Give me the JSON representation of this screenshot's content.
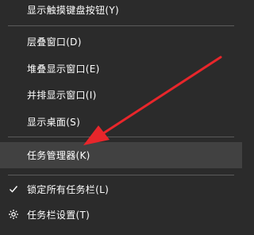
{
  "menu": {
    "items": [
      {
        "label": "显示触摸键盘按钮(Y)"
      },
      {
        "label": "层叠窗口(D)"
      },
      {
        "label": "堆叠显示窗口(E)"
      },
      {
        "label": "并排显示窗口(I)"
      },
      {
        "label": "显示桌面(S)"
      },
      {
        "label": "任务管理器(K)"
      },
      {
        "label": "锁定所有任务栏(L)"
      },
      {
        "label": "任务栏设置(T)"
      }
    ],
    "icons": {
      "lock": "checkmark-icon",
      "settings": "gear-icon"
    },
    "colors": {
      "background": "#2b2b2b",
      "highlight": "#414141",
      "annotation_arrow": "#e8262b"
    }
  }
}
